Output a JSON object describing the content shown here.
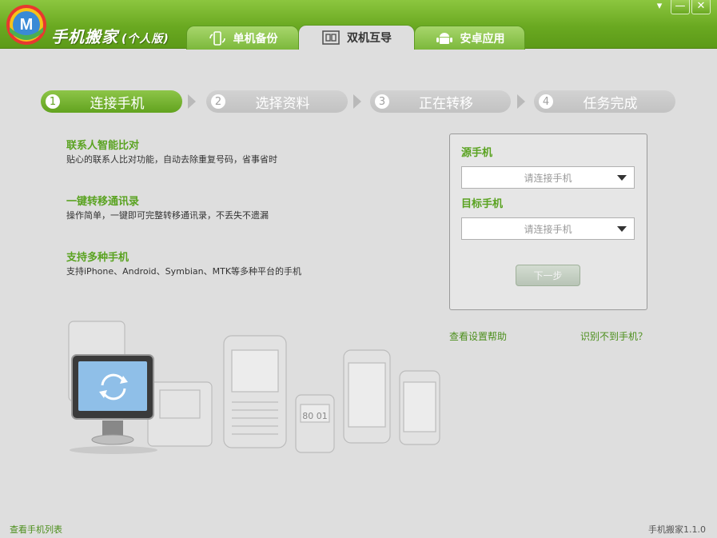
{
  "app": {
    "title": "手机搬家",
    "edition": "(个人版)"
  },
  "tabs": [
    {
      "label": "单机备份",
      "active": false
    },
    {
      "label": "双机互导",
      "active": true
    },
    {
      "label": "安卓应用",
      "active": false
    }
  ],
  "window_controls": {
    "menu": "▾",
    "minimize": "—",
    "close": "✕"
  },
  "steps": [
    {
      "num": "1",
      "label": "连接手机",
      "active": true
    },
    {
      "num": "2",
      "label": "选择资料",
      "active": false
    },
    {
      "num": "3",
      "label": "正在转移",
      "active": false
    },
    {
      "num": "4",
      "label": "任务完成",
      "active": false
    }
  ],
  "features": [
    {
      "title": "联系人智能比对",
      "desc": "贴心的联系人比对功能，自动去除重复号码，省事省时"
    },
    {
      "title": "一键转移通讯录",
      "desc": "操作简单，一键即可完整转移通讯录，不丢失不遗漏"
    },
    {
      "title": "支持多种手机",
      "desc": "支持iPhone、Android、Symbian、MTK等多种平台的手机"
    }
  ],
  "panel": {
    "source_label": "源手机",
    "source_value": "请连接手机",
    "target_label": "目标手机",
    "target_value": "请连接手机",
    "next_label": "下一步"
  },
  "links": {
    "help": "查看设置帮助",
    "not_found": "识别不到手机？"
  },
  "footer": {
    "phone_list": "查看手机列表",
    "version": "手机搬家1.1.0"
  },
  "illustration": {
    "phone_clock": "80 01"
  },
  "colors": {
    "brand_green": "#6aa921",
    "accent_text": "#5aa321",
    "link": "#4c8f1c"
  }
}
